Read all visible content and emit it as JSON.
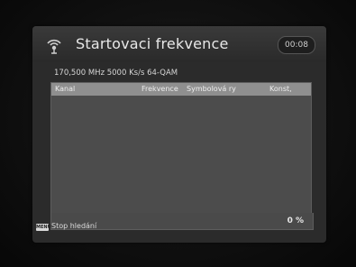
{
  "header": {
    "title": "Startovaci frekvence",
    "clock": "00:08",
    "icon": "satellite-dish-icon"
  },
  "scan_info": "170,500 MHz  5000 Ks/s  64-QAM",
  "table": {
    "columns": [
      "Kanal",
      "Frekvence",
      "Symbolová ry",
      "Konst,"
    ],
    "rows": []
  },
  "progress": {
    "percent": 0,
    "label": "0 %"
  },
  "footer": {
    "key_label": "MENU",
    "action_label": "Stop hledání"
  },
  "colors": {
    "osd_background": "#2b2b2b",
    "table_header": "#8f8f8f",
    "table_body": "#4c4c4c"
  }
}
